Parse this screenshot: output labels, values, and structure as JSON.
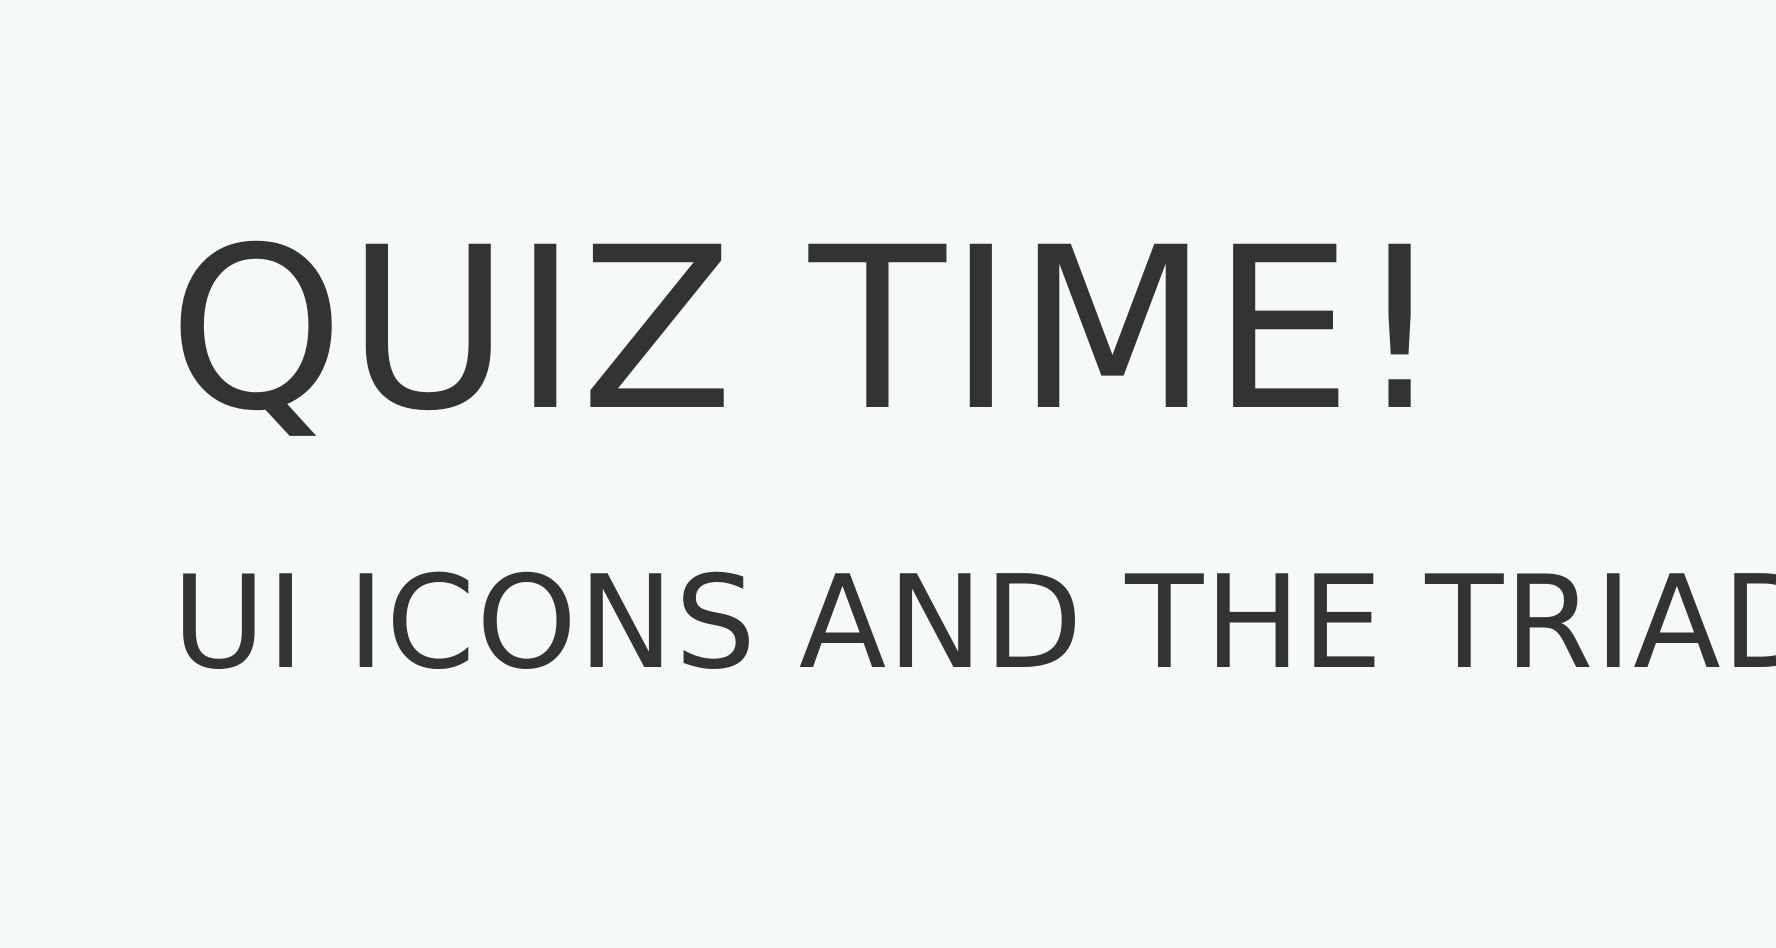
{
  "slide": {
    "title": "QUIZ TIME!",
    "subtitle": "UI ICONS AND THE TRIAD"
  },
  "colors": {
    "background": "#f6f9fa",
    "text": "#333333"
  }
}
